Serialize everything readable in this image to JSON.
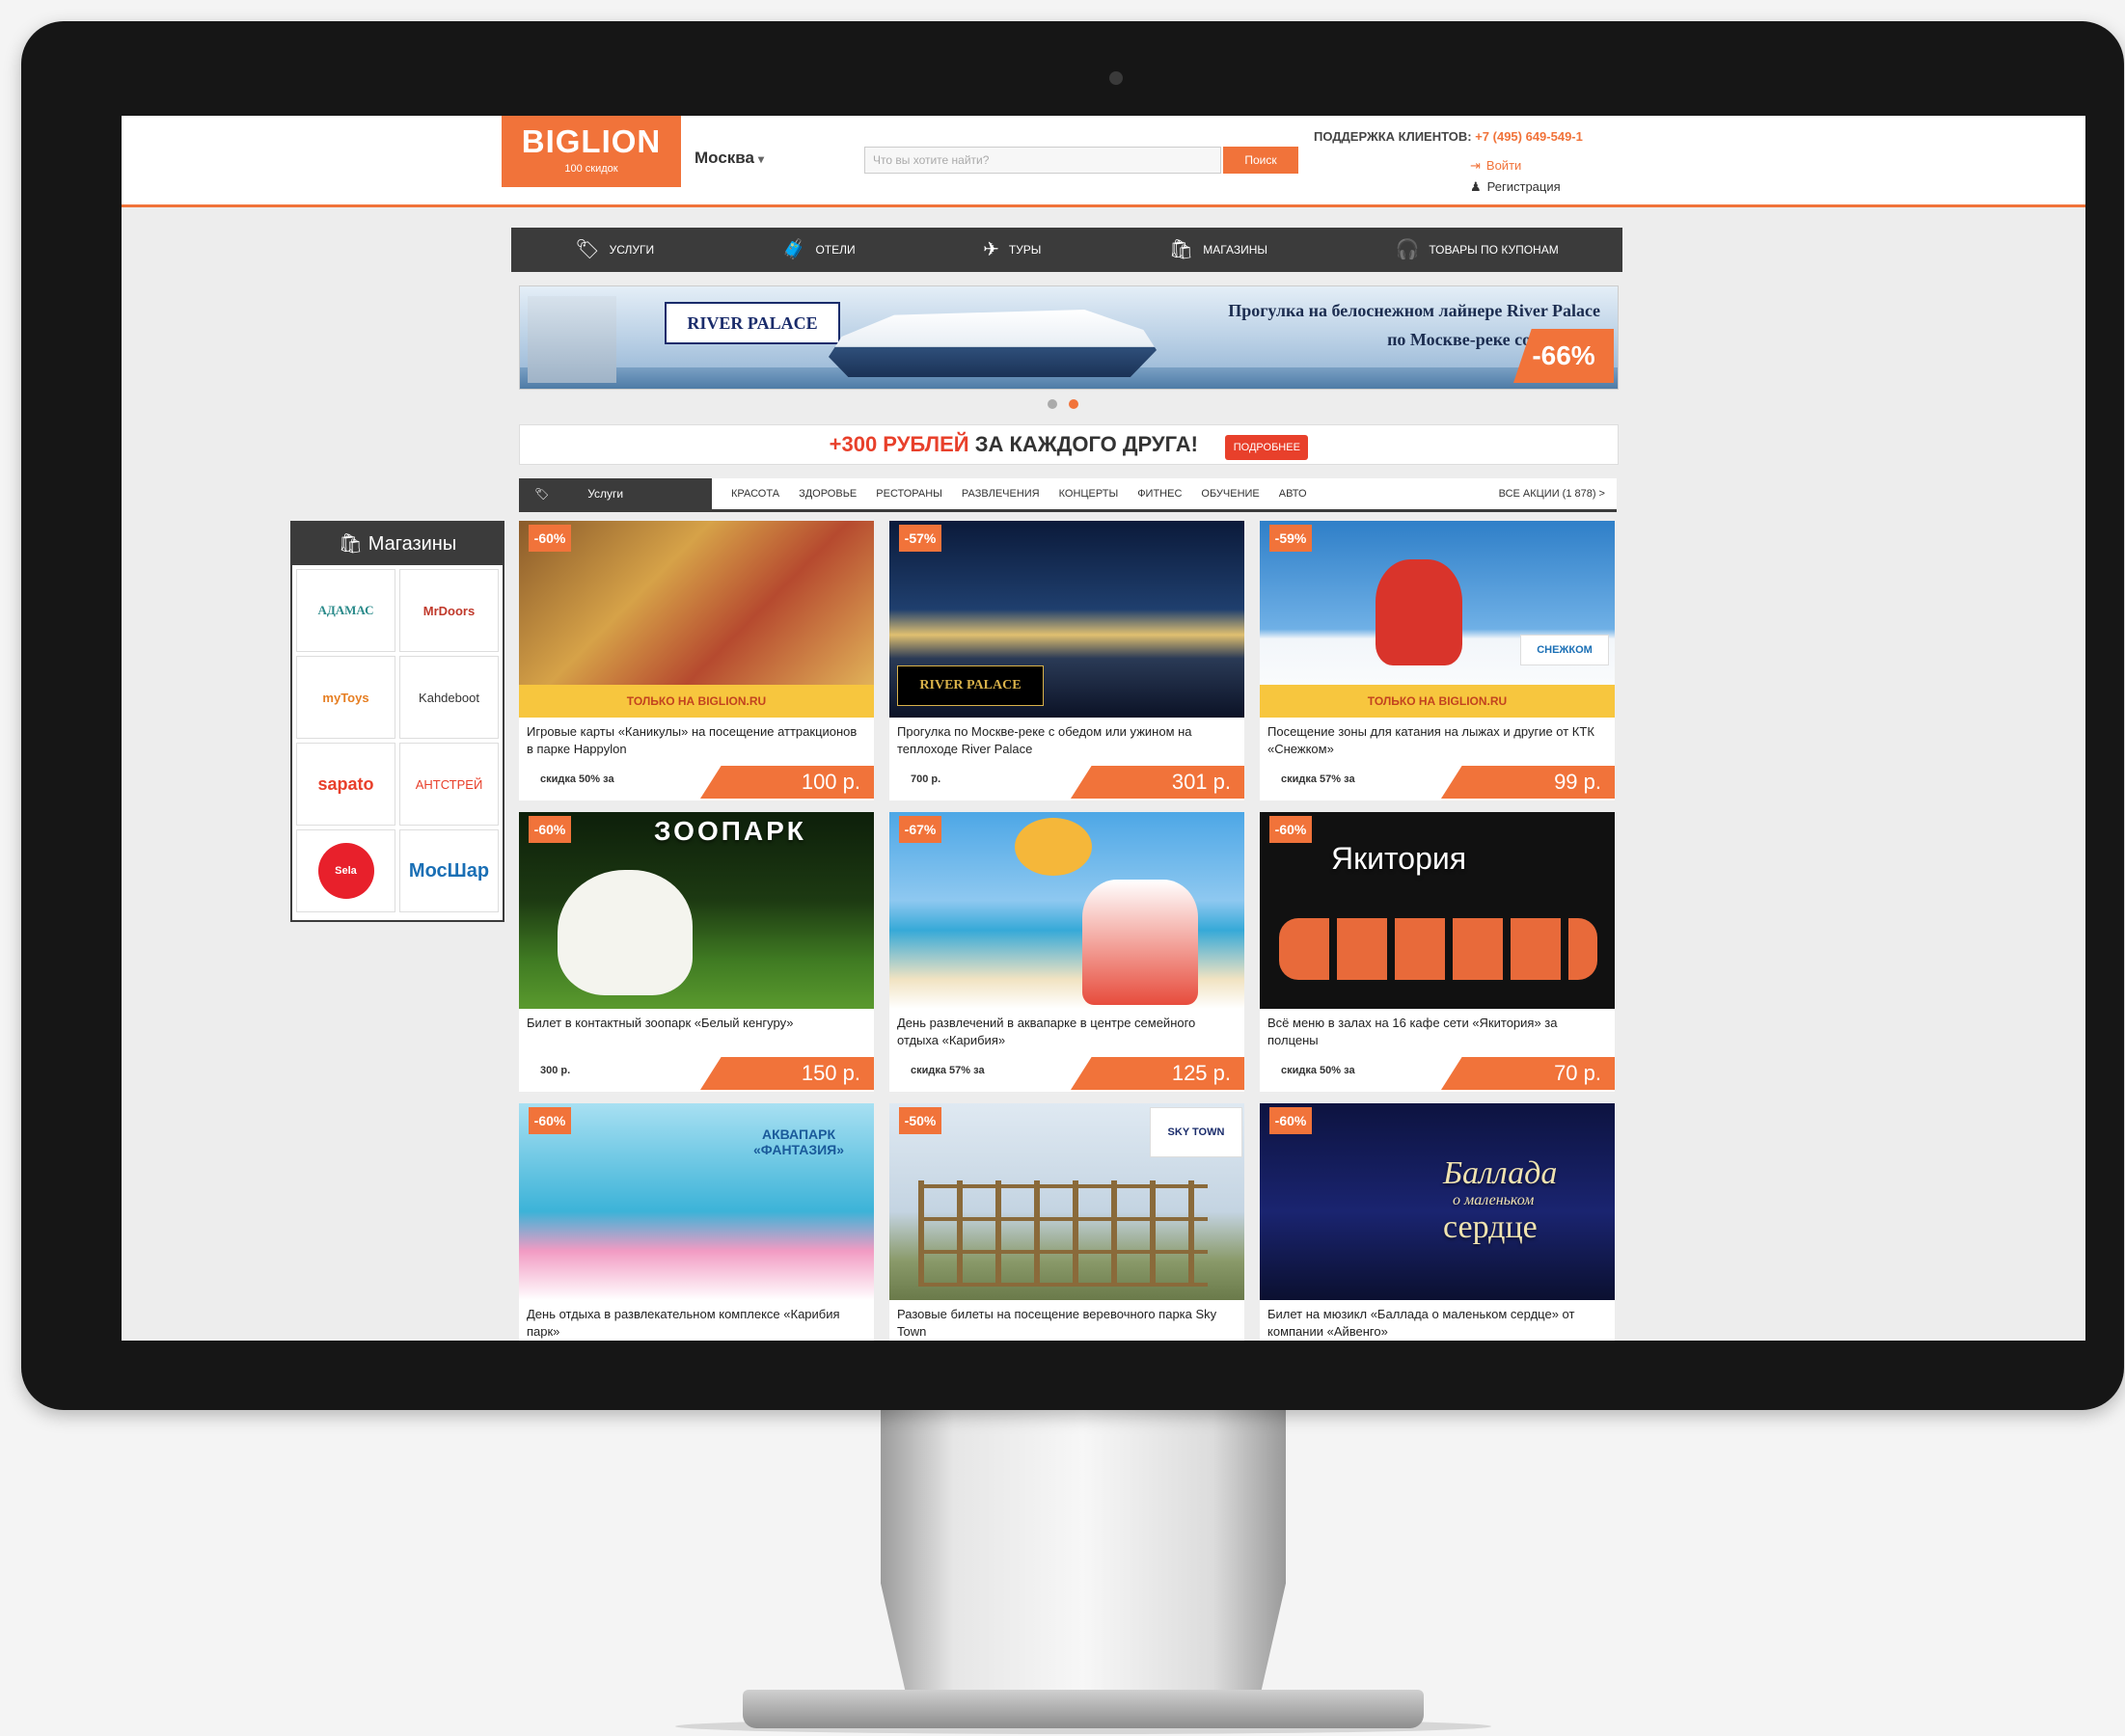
{
  "header": {
    "logo": "BIGLION",
    "logo_sub": "100 скидок",
    "city": "Москва",
    "search_placeholder": "Что вы хотите найти?",
    "search_button": "Поиск",
    "support_label": "ПОДДЕРЖКА КЛИЕНТОВ:",
    "support_phone": "+7 (495) 649-549-1",
    "login": "Войти",
    "register": "Регистрация"
  },
  "nav": {
    "items": [
      {
        "label": "Услуги",
        "icon": "tag-icon"
      },
      {
        "label": "Отели",
        "icon": "suitcase-icon"
      },
      {
        "label": "Туры",
        "icon": "plane-icon"
      },
      {
        "label": "Магазины",
        "icon": "shopping-bag-icon"
      },
      {
        "label": "Товары по купонам",
        "icon": "headphones-icon"
      }
    ]
  },
  "banner": {
    "brand": "RIVER PALACE",
    "headline_line1": "Прогулка на белоснежном лайнере River Palace",
    "headline_line2": "по Москве-реке со скидкой",
    "discount": "-66%"
  },
  "promo": {
    "accent": "+300 РУБЛЕЙ",
    "text": " ЗА КАЖДОГО ДРУГА!",
    "button": "ПОДРОБНЕЕ"
  },
  "categories": {
    "active": "Услуги",
    "items": [
      "Красота",
      "Здоровье",
      "Рестораны",
      "Развлечения",
      "Концерты",
      "Фитнес",
      "Обучение",
      "Авто"
    ],
    "all": "ВСЕ АКЦИИ (1 878) >"
  },
  "shops": {
    "title": "Магазины",
    "items": [
      "АДАМАС",
      "MrDoors",
      "myToys",
      "Kahdeboot",
      "sapato",
      "АНТСТРЕЙ",
      "Sela",
      "МосШар"
    ]
  },
  "deals": [
    {
      "badge": "-60%",
      "strip": "ТОЛЬКО НА BIGLION.RU",
      "title": "Игровые карты «Каникулы» на посещение аттракционов в парке Happylon",
      "saving": "скидка 50% за",
      "price": "100 р."
    },
    {
      "badge": "-57%",
      "strip": "",
      "title": "Прогулка по Москве-реке с обедом или ужином на теплоходе River Palace",
      "saving": "700 р.",
      "price": "301 р."
    },
    {
      "badge": "-59%",
      "strip": "ТОЛЬКО НА BIGLION.RU",
      "title": "Посещение зоны для катания на лыжах и другие от КТК «Снежком»",
      "saving": "скидка 57% за",
      "price": "99 р."
    },
    {
      "badge": "-60%",
      "strip": "",
      "title": "Билет в контактный зоопарк «Белый кенгуру»",
      "saving": "300 р.",
      "price": "150 р."
    },
    {
      "badge": "-67%",
      "strip": "",
      "title": "День развлечений в аквапарке в центре семейного отдыха «Карибия»",
      "saving": "скидка 57% за",
      "price": "125 р."
    },
    {
      "badge": "-60%",
      "strip": "",
      "title": "Всё меню в залах на 16 кафе сети «Якитория» за полцены",
      "saving": "скидка 50% за",
      "price": "70 р."
    },
    {
      "badge": "-60%",
      "strip": "",
      "title": "День отдыха в развлекательном комплексе «Карибия парк»",
      "saving": "",
      "price": ""
    },
    {
      "badge": "-50%",
      "strip": "",
      "title": "Разовые билеты на посещение веревочного парка Sky Town",
      "saving": "",
      "price": ""
    },
    {
      "badge": "-60%",
      "strip": "",
      "title": "Билет на мюзикл «Баллада о маленьком сердце» от компании «Айвенго»",
      "saving": "",
      "price": ""
    }
  ],
  "deal_overlays": {
    "zoo": "ЗООПАРК",
    "yakitoria": "Якитория",
    "ballada_1": "Баллада",
    "ballada_2": "о маленьком",
    "ballada_3": "сердце",
    "aquapark": "АКВАПАРК «ФАНТАЗИЯ»",
    "skytown": "SKY TOWN",
    "river_logo": "RIVER PALACE",
    "ski_logo": "СНЕЖКОМ"
  },
  "colors": {
    "brand": "#f1733a",
    "nav_bg": "#3b3b3b",
    "promo_red": "#e8402b"
  }
}
